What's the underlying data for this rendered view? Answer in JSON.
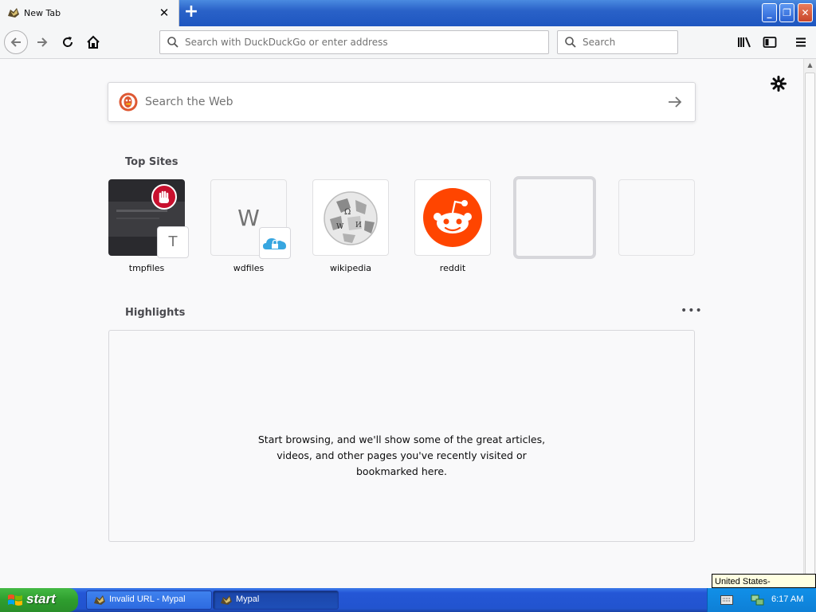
{
  "browser": {
    "tab": {
      "title": "New Tab"
    },
    "url_placeholder": "Search with DuckDuckGo or enter address",
    "search_placeholder": "Search"
  },
  "newtab": {
    "web_search_placeholder": "Search the Web",
    "top_sites_title": "Top Sites",
    "top_sites": [
      {
        "label": "tmpfiles",
        "badge": "T",
        "icon": "tmpfiles-screenshot"
      },
      {
        "label": "wdfiles",
        "letter": "W",
        "icon": "cloud-lock-icon"
      },
      {
        "label": "wikipedia",
        "icon": "wikipedia-globe-icon"
      },
      {
        "label": "reddit",
        "icon": "reddit-alien-icon"
      }
    ],
    "highlights_title": "Highlights",
    "highlights_empty_lines": [
      "Start browsing, and we'll show some of the great articles,",
      "videos, and other pages you've recently visited or",
      "bookmarked here."
    ],
    "highlights_menu": "•••"
  },
  "os": {
    "tooltip": "United States-International",
    "start_label": "start",
    "tasks": [
      {
        "label": "Invalid URL - Mypal"
      },
      {
        "label": "Mypal"
      }
    ],
    "clock": "6:17 AM"
  },
  "colors": {
    "reddit": "#ff4500",
    "accent_blue": "#2a62c8",
    "start_green": "#2e9e2e"
  }
}
